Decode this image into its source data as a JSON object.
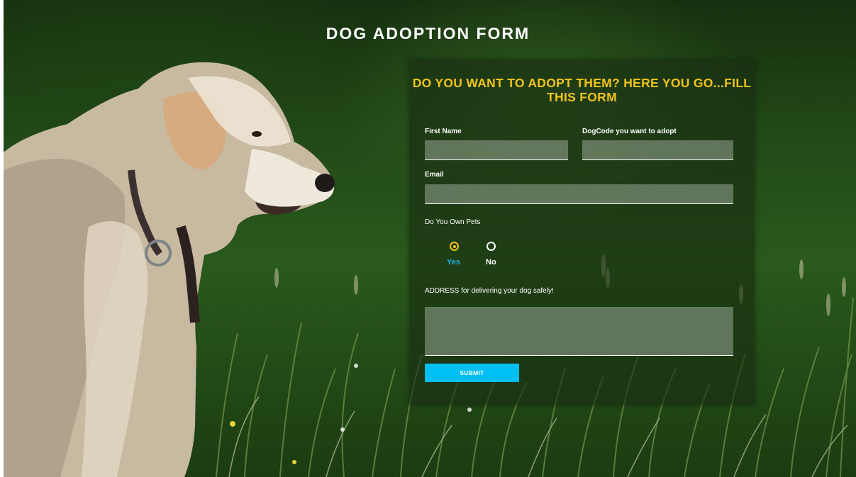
{
  "page": {
    "title": "DOG ADOPTION FORM"
  },
  "form": {
    "heading": "DO YOU WANT TO ADOPT THEM? HERE YOU GO...FILL THIS FORM",
    "first_name": {
      "label": "First Name",
      "value": ""
    },
    "dog_code": {
      "label": "DogCode you want to adopt",
      "value": ""
    },
    "email": {
      "label": "Email",
      "value": ""
    },
    "own_pets": {
      "label": "Do You Own Pets",
      "options": [
        "Yes",
        "No"
      ],
      "selected": "Yes"
    },
    "address": {
      "label": "ADDRESS for delivering your dog safely!",
      "value": ""
    },
    "submit_label": "SUBMIT"
  },
  "colors": {
    "heading": "#f2c31b",
    "submit": "#00bff2",
    "selected_option": "#1fb3e8"
  }
}
